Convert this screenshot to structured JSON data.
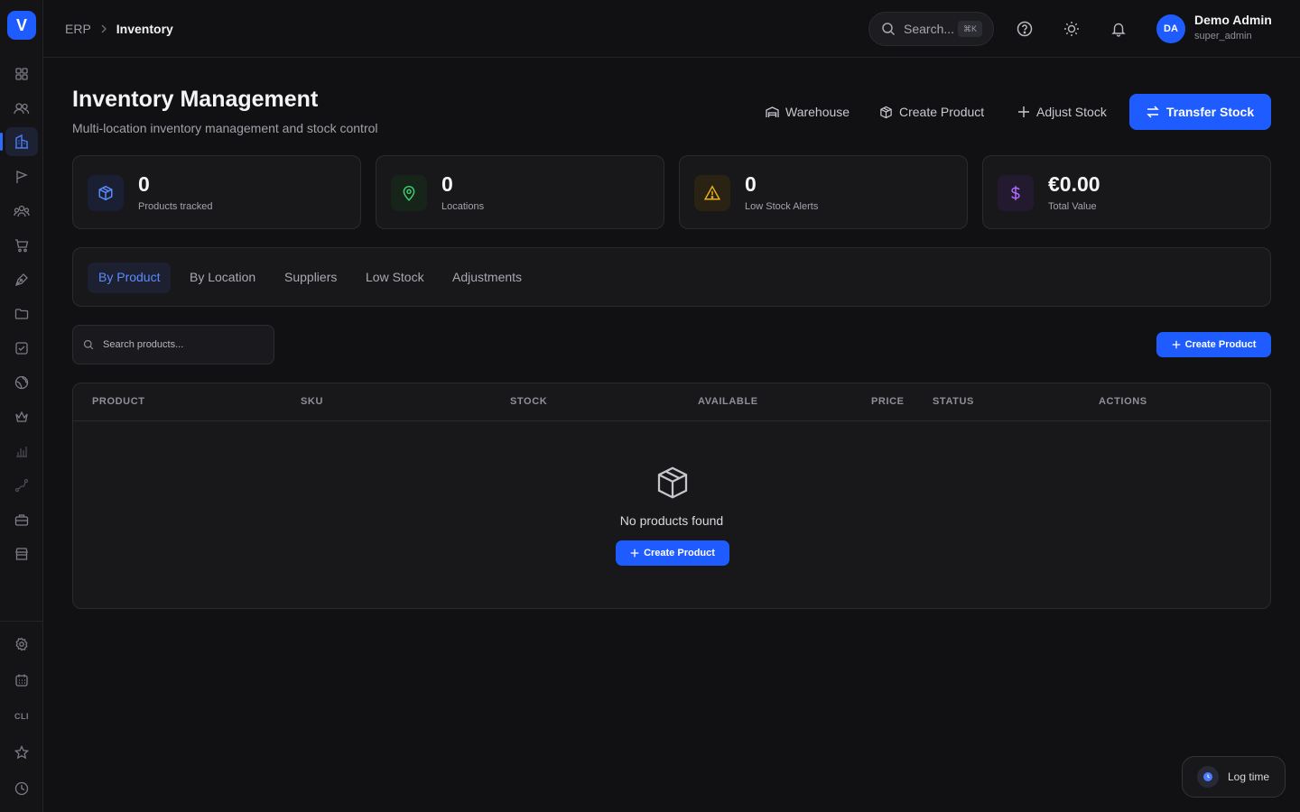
{
  "app": {
    "logo_letter": "V"
  },
  "sidebar": {
    "items": [
      {
        "icon": "grid-icon"
      },
      {
        "icon": "users-icon"
      },
      {
        "icon": "building-icon",
        "active": true
      },
      {
        "icon": "flag-icon"
      },
      {
        "icon": "team-icon"
      },
      {
        "icon": "cart-icon"
      },
      {
        "icon": "pen-icon"
      },
      {
        "icon": "folder-icon"
      },
      {
        "icon": "checkbox-icon"
      },
      {
        "icon": "globe-icon"
      },
      {
        "icon": "crown-icon"
      },
      {
        "icon": "bar-chart-icon"
      },
      {
        "icon": "route-icon"
      },
      {
        "icon": "briefcase-icon"
      },
      {
        "icon": "store-icon"
      }
    ],
    "bottom": [
      {
        "icon": "gear-icon"
      },
      {
        "icon": "calculator-icon"
      },
      {
        "icon": "cli-icon",
        "label": "CLI"
      },
      {
        "icon": "star-icon"
      },
      {
        "icon": "clock-icon"
      }
    ]
  },
  "topbar": {
    "breadcrumb_root": "ERP",
    "breadcrumb_separator": ">",
    "breadcrumb_current": "Inventory",
    "search_label": "Search...",
    "search_shortcut": "⌘K",
    "user_initials": "DA",
    "user_name": "Demo Admin",
    "user_role": "super_admin"
  },
  "header": {
    "title": "Inventory Management",
    "subtitle": "Multi-location inventory management and stock control",
    "warehouse_label": "Warehouse",
    "create_product_label": "Create Product",
    "adjust_stock_label": "Adjust Stock",
    "transfer_stock_label": "Transfer Stock"
  },
  "stats": [
    {
      "value": "0",
      "label": "Products tracked",
      "icon": "cube-icon",
      "color": "#5a8cff",
      "bg": "#1a1f33"
    },
    {
      "value": "0",
      "label": "Locations",
      "icon": "map-pin-icon",
      "color": "#3ecf6f",
      "bg": "#172419"
    },
    {
      "value": "0",
      "label": "Low Stock Alerts",
      "icon": "warning-icon",
      "color": "#e8b21c",
      "bg": "#2a2213"
    },
    {
      "value": "€0.00",
      "label": "Total Value",
      "icon": "dollar-icon",
      "color": "#b06cff",
      "bg": "#241a30"
    }
  ],
  "tabs": [
    {
      "label": "By Product",
      "active": true
    },
    {
      "label": "By Location"
    },
    {
      "label": "Suppliers"
    },
    {
      "label": "Low Stock"
    },
    {
      "label": "Adjustments"
    }
  ],
  "products": {
    "search_placeholder": "Search products...",
    "create_label": "Create Product",
    "columns": [
      "PRODUCT",
      "SKU",
      "STOCK",
      "AVAILABLE",
      "PRICE",
      "STATUS",
      "ACTIONS"
    ],
    "empty_text": "No products found",
    "empty_create_label": "Create Product"
  },
  "log_time": {
    "label": "Log time"
  },
  "colors": {
    "accent": "#1f5cff",
    "background": "#111114",
    "card": "#18181b"
  }
}
